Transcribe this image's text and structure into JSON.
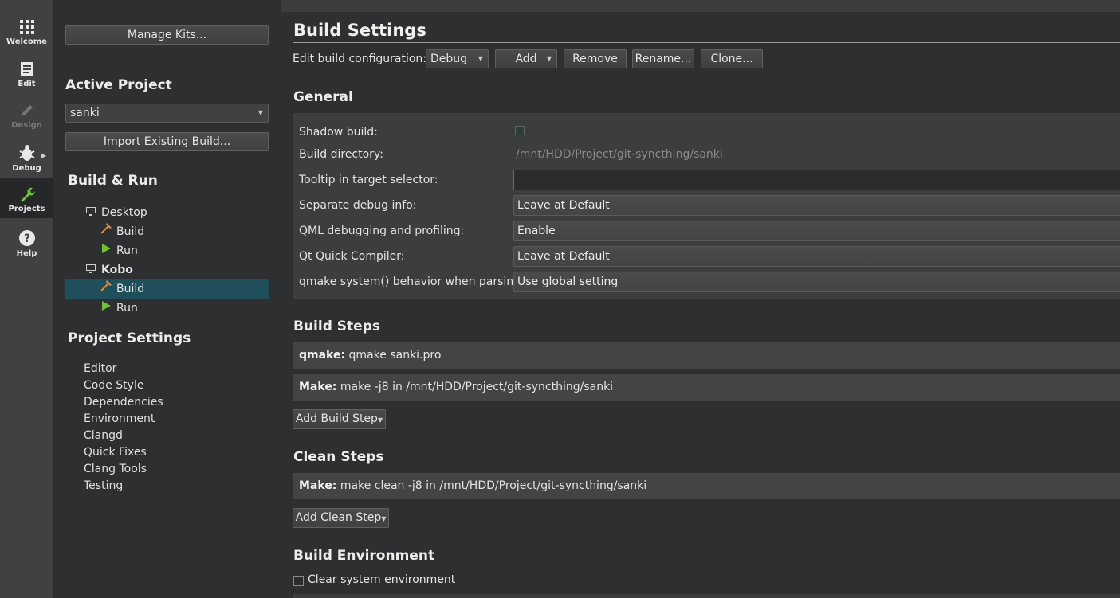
{
  "modebar": {
    "items": [
      {
        "label": "Welcome",
        "icon": "grid-icon"
      },
      {
        "label": "Edit",
        "icon": "document-icon"
      },
      {
        "label": "Design",
        "icon": "pencil-icon"
      },
      {
        "label": "Debug",
        "icon": "bug-icon"
      },
      {
        "label": "Projects",
        "icon": "wrench-icon"
      },
      {
        "label": "Help",
        "icon": "help-icon"
      }
    ]
  },
  "nav": {
    "manage_kits": "Manage Kits...",
    "active_project_heading": "Active Project",
    "active_project_value": "sanki",
    "import_existing": "Import Existing Build...",
    "build_run_heading": "Build & Run",
    "desktop": "Desktop",
    "desktop_build": "Build",
    "desktop_run": "Run",
    "kobo": "Kobo",
    "kobo_build": "Build",
    "kobo_run": "Run",
    "project_settings_heading": "Project Settings",
    "settings_items": [
      "Editor",
      "Code Style",
      "Dependencies",
      "Environment",
      "Clangd",
      "Quick Fixes",
      "Clang Tools",
      "Testing"
    ]
  },
  "main": {
    "title": "Build Settings",
    "edit_config_label": "Edit build configuration:",
    "config_value": "Debug",
    "add_label": "Add",
    "remove_label": "Remove",
    "rename_label": "Rename...",
    "clone_label": "Clone...",
    "general_heading": "General",
    "shadow_build_label": "Shadow build:",
    "build_dir_label": "Build directory:",
    "build_dir_value": "/mnt/HDD/Project/git-syncthing/sanki",
    "tooltip_label": "Tooltip in target selector:",
    "sep_debug_label": "Separate debug info:",
    "sep_debug_value": "Leave at Default",
    "qml_label": "QML debugging and profiling:",
    "qml_value": "Enable",
    "quick_compiler_label": "Qt Quick Compiler:",
    "quick_compiler_value": "Leave at Default",
    "qmake_behavior_label": "qmake system() behavior when parsing:",
    "qmake_behavior_value": "Use global setting",
    "build_steps_heading": "Build Steps",
    "step_qmake_name": "qmake:",
    "step_qmake_value": "qmake sanki.pro",
    "step_make_name": "Make:",
    "step_make_value": "make -j8 in /mnt/HDD/Project/git-syncthing/sanki",
    "add_build_step": "Add Build Step",
    "clean_steps_heading": "Clean Steps",
    "clean_make_name": "Make:",
    "clean_make_value": "make clean -j8 in /mnt/HDD/Project/git-syncthing/sanki",
    "add_clean_step": "Add Clean Step",
    "build_env_heading": "Build Environment",
    "clear_env_label": "Clear system environment"
  },
  "colors": {
    "accent_green": "#6fbf3a",
    "selection": "#1f4f5a",
    "build_hammer": "#e08a3c"
  }
}
